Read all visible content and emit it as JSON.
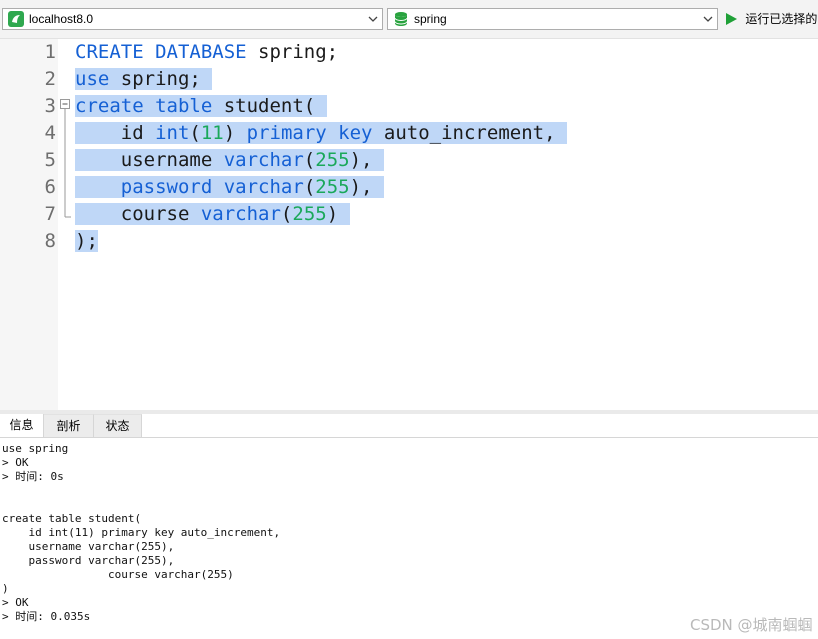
{
  "toolbar": {
    "connection": "localhost8.0",
    "database": "spring",
    "run_label": "运行已选择的"
  },
  "editor": {
    "line_numbers": [
      "1",
      "2",
      "3",
      "4",
      "5",
      "6",
      "7",
      "8"
    ]
  },
  "bottom_tabs": [
    "信息",
    "剖析",
    "状态"
  ],
  "log_lines": [
    "use spring",
    "> OK",
    "> 时间: 0s",
    "",
    "",
    "create table student(",
    "    id int(11) primary key auto_increment,",
    "    username varchar(255),",
    "    password varchar(255),",
    "                course varchar(255)",
    ")",
    "> OK",
    "> 时间: 0.035s"
  ],
  "watermark": "CSDN @城南蝈蝈",
  "colors": {
    "keyword": "#1560d4",
    "number": "#1aa85a",
    "selection": "#bfd7f7"
  }
}
